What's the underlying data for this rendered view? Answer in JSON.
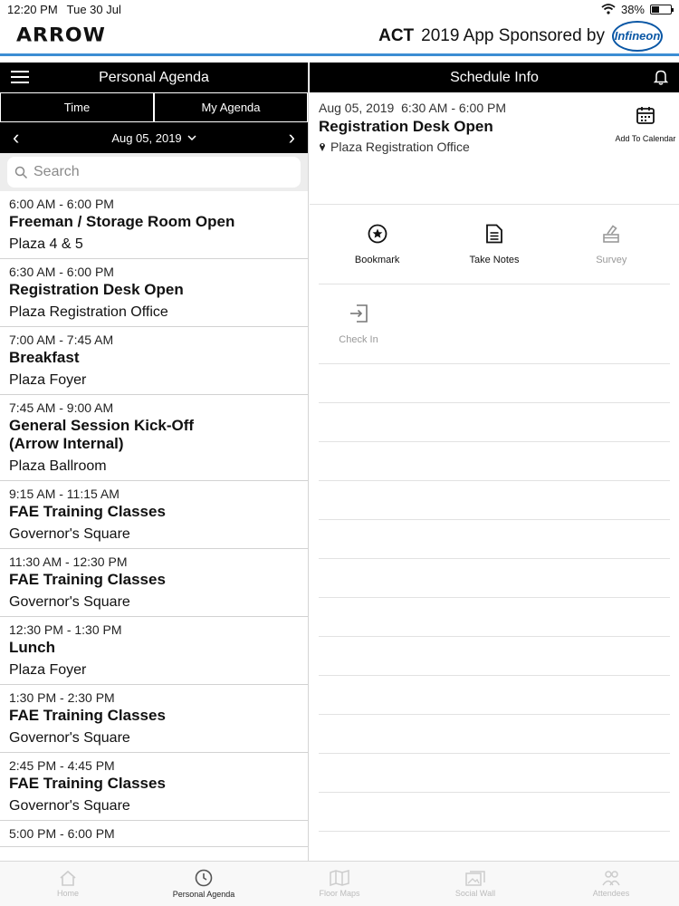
{
  "status": {
    "time": "12:20 PM",
    "date": "Tue 30 Jul",
    "battery": "38%",
    "battery_level": 0.38
  },
  "brand": {
    "logo": "ARROW",
    "sponsor_act": "ACT",
    "sponsor_text": "2019 App Sponsored by",
    "sponsor_logo": "Infineon"
  },
  "left": {
    "title": "Personal Agenda",
    "tabs": [
      "Time",
      "My Agenda"
    ],
    "date": "Aug 05, 2019",
    "search_placeholder": "Search",
    "items": [
      {
        "time": "6:00 AM - 6:00 PM",
        "title": "Freeman / Storage Room Open",
        "location": "Plaza 4 & 5"
      },
      {
        "time": "6:30 AM - 6:00 PM",
        "title": "Registration Desk Open",
        "location": "Plaza Registration Office"
      },
      {
        "time": "7:00 AM - 7:45 AM",
        "title": "Breakfast",
        "location": "Plaza Foyer"
      },
      {
        "time": "7:45 AM - 9:00 AM",
        "title": "General Session Kick-Off (Arrow Internal)",
        "location": "Plaza Ballroom"
      },
      {
        "time": "9:15 AM - 11:15 AM",
        "title": "FAE Training Classes",
        "location": "Governor's Square"
      },
      {
        "time": "11:30 AM - 12:30 PM",
        "title": "FAE Training Classes",
        "location": "Governor's Square"
      },
      {
        "time": "12:30 PM - 1:30 PM",
        "title": "Lunch",
        "location": "Plaza Foyer"
      },
      {
        "time": "1:30 PM - 2:30 PM",
        "title": "FAE Training Classes",
        "location": "Governor's Square"
      },
      {
        "time": "2:45 PM - 4:45 PM",
        "title": "FAE Training Classes",
        "location": "Governor's Square"
      },
      {
        "time": "5:00 PM - 6:00 PM",
        "title": "",
        "location": ""
      }
    ]
  },
  "right": {
    "title": "Schedule Info",
    "when": "Aug 05, 2019  6:30 AM - 6:00 PM",
    "event_title": "Registration Desk Open",
    "location": "Plaza Registration Office",
    "add_calendar": "Add To Calendar",
    "actions": [
      {
        "label": "Bookmark",
        "icon": "bookmark-star-icon"
      },
      {
        "label": "Take Notes",
        "icon": "notes-icon"
      },
      {
        "label": "Survey",
        "icon": "survey-icon"
      }
    ],
    "check_in": "Check In"
  },
  "tabbar": [
    "Home",
    "Personal Agenda",
    "Floor Maps",
    "Social Wall",
    "Attendees"
  ]
}
